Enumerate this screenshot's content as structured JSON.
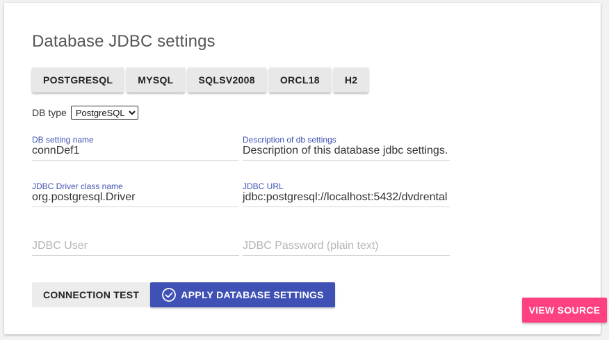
{
  "page": {
    "title": "Database JDBC settings"
  },
  "db_buttons": [
    "POSTGRESQL",
    "MYSQL",
    "SQLSV2008",
    "ORCL18",
    "H2"
  ],
  "db_type": {
    "label": "DB type",
    "selected": "PostgreSQL"
  },
  "fields": {
    "setting_name": {
      "label": "DB setting name",
      "value": "connDef1"
    },
    "description": {
      "label": "Description of db settings",
      "value": "Description of this database jdbc settings."
    },
    "driver_class": {
      "label": "JDBC Driver class name",
      "value": "org.postgresql.Driver"
    },
    "jdbc_url": {
      "label": "JDBC URL",
      "value": "jdbc:postgresql://localhost:5432/dvdrental"
    },
    "jdbc_user": {
      "placeholder": "JDBC User"
    },
    "jdbc_password": {
      "placeholder": "JDBC Password (plain text)"
    }
  },
  "actions": {
    "connection_test": "CONNECTION TEST",
    "apply": "APPLY DATABASE SETTINGS",
    "apply_icon": "check-circle-icon",
    "view_source": "VIEW SOURCE"
  },
  "colors": {
    "primary": "#3f51b5",
    "accent": "#ff4081",
    "label": "#3f51b5",
    "placeholder": "#b5b5b5"
  }
}
